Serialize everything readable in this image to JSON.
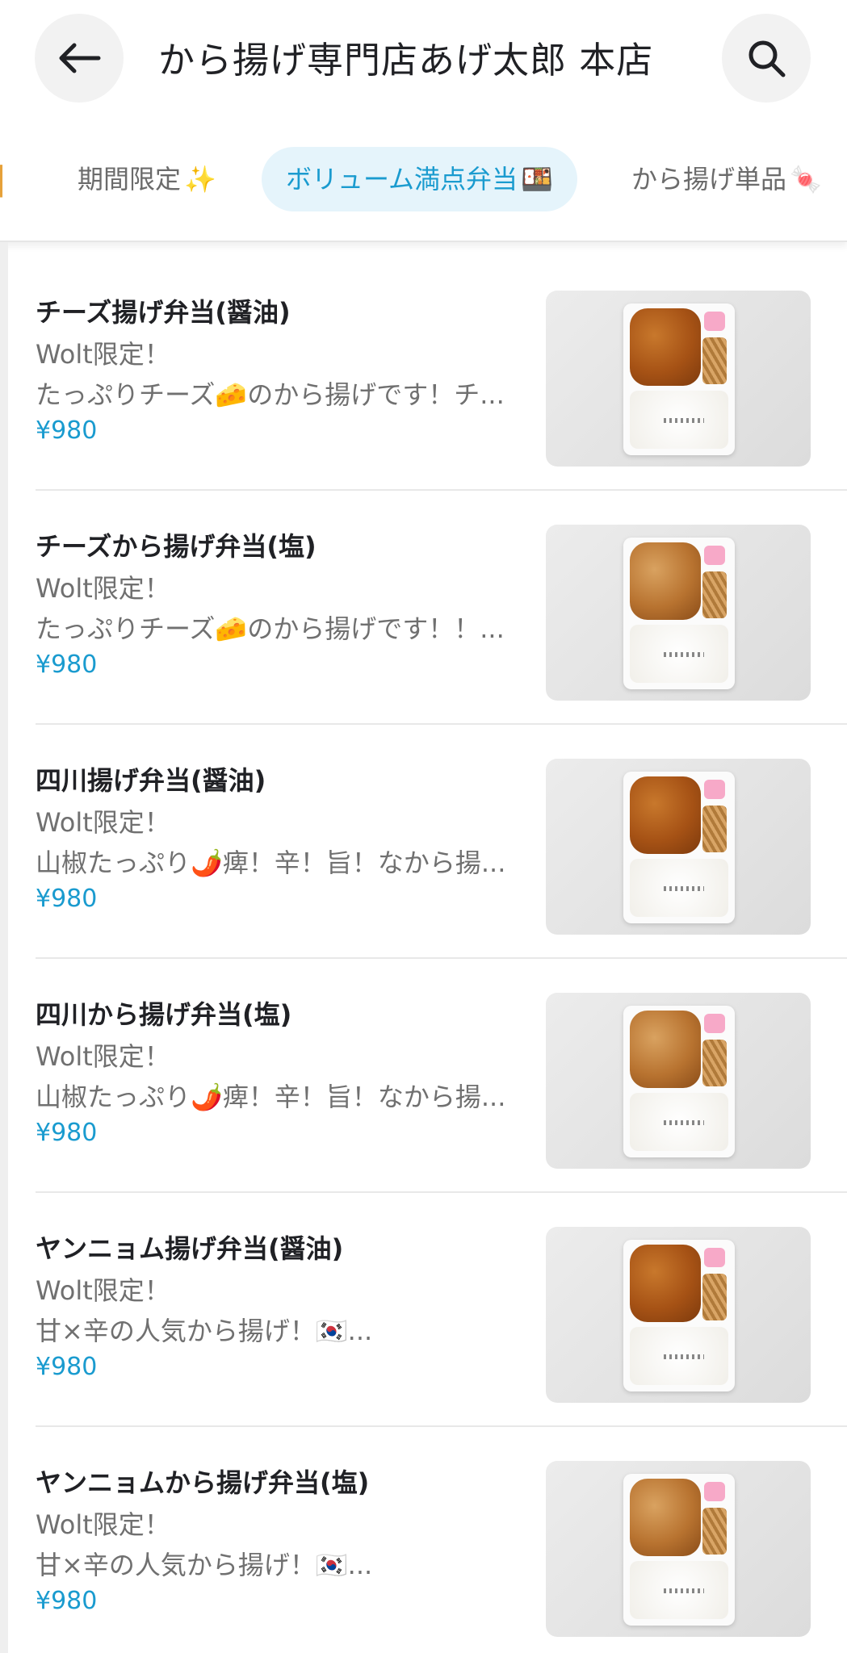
{
  "header": {
    "title": "から揚げ専門店あげ太郎 本店",
    "back_icon": "arrow-left-icon",
    "search_icon": "search-icon"
  },
  "tabs": [
    {
      "label": "期間限定",
      "emoji": "✨"
    },
    {
      "label": "ボリューム満点弁当",
      "emoji": "🍱"
    },
    {
      "label": "から揚げ単品",
      "emoji": "🍬"
    }
  ],
  "items": [
    {
      "name": "チーズ揚げ弁当(醤油)",
      "line1": "Wolt限定！",
      "line2": "たっぷりチーズ🧀のから揚げです！チ...",
      "price": "¥980"
    },
    {
      "name": "チーズから揚げ弁当(塩)",
      "line1": "Wolt限定！",
      "line2": "たっぷりチーズ🧀のから揚げです！！...",
      "price": "¥980"
    },
    {
      "name": "四川揚げ弁当(醤油)",
      "line1": "Wolt限定！",
      "line2": "山椒たっぷり🌶️痺！辛！旨！なから揚...",
      "price": "¥980"
    },
    {
      "name": "四川から揚げ弁当(塩)",
      "line1": "Wolt限定！",
      "line2": "山椒たっぷり🌶️痺！辛！旨！なから揚...",
      "price": "¥980"
    },
    {
      "name": "ヤンニョム揚げ弁当(醤油)",
      "line1": "Wolt限定！",
      "line2": "甘×辛の人気から揚げ！🇰🇷...",
      "price": "¥980"
    },
    {
      "name": "ヤンニョムから揚げ弁当(塩)",
      "line1": "Wolt限定！",
      "line2": "甘×辛の人気から揚げ！🇰🇷...",
      "price": "¥980"
    }
  ],
  "colors": {
    "accent": "#1a9bcf",
    "active_tab_bg": "#e5f4fb"
  }
}
